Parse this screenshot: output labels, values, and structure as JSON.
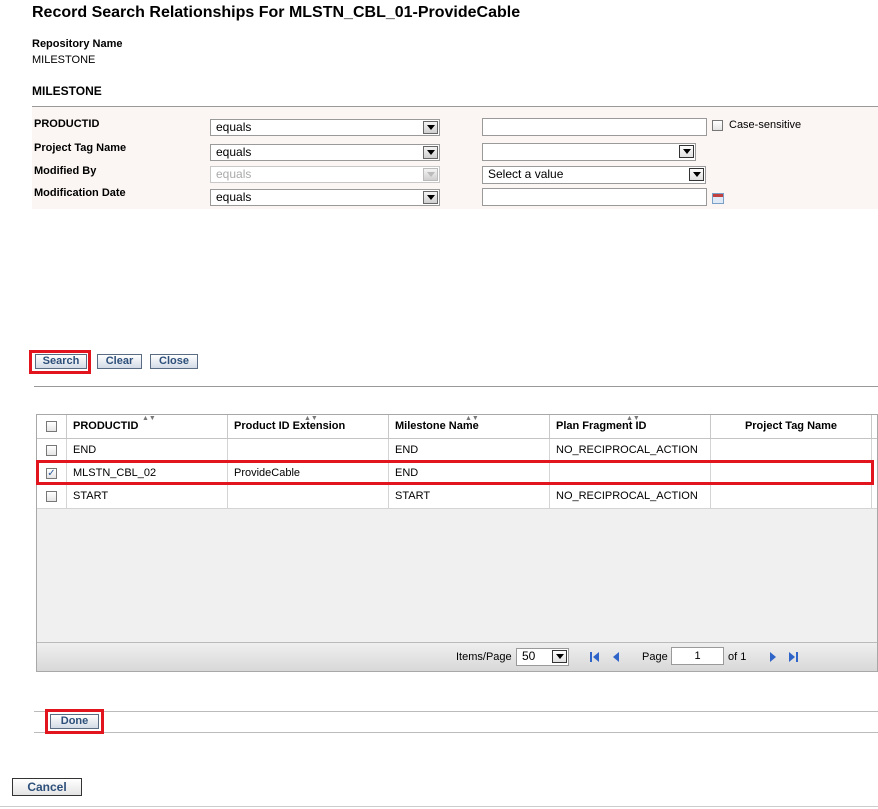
{
  "page_title": "Record Search Relationships For MLSTN_CBL_01-ProvideCable",
  "repository": {
    "label": "Repository Name",
    "value": "MILESTONE"
  },
  "section_title": "MILESTONE",
  "criteria": [
    {
      "label": "PRODUCTID",
      "operator": "equals",
      "value": "",
      "case_label": "Case-sensitive"
    },
    {
      "label": "Project Tag Name",
      "operator": "equals",
      "value": ""
    },
    {
      "label": "Modified By",
      "operator": "equals",
      "value": "Select a value"
    },
    {
      "label": "Modification Date",
      "operator": "equals",
      "value": ""
    }
  ],
  "buttons": {
    "search": "Search",
    "clear": "Clear",
    "close": "Close",
    "done": "Done",
    "cancel": "Cancel"
  },
  "table": {
    "columns": [
      "PRODUCTID",
      "Product ID Extension",
      "Milestone Name",
      "Plan Fragment ID",
      "Project Tag Name"
    ],
    "rows": [
      {
        "checked": false,
        "cells": [
          "END",
          "",
          "END",
          "NO_RECIPROCAL_ACTION",
          ""
        ]
      },
      {
        "checked": true,
        "cells": [
          "MLSTN_CBL_02",
          "ProvideCable",
          "END",
          "",
          ""
        ]
      },
      {
        "checked": false,
        "cells": [
          "START",
          "",
          "START",
          "NO_RECIPROCAL_ACTION",
          ""
        ]
      }
    ]
  },
  "pager": {
    "items_label": "Items/Page",
    "items_value": "50",
    "page_label": "Page",
    "page_value": "1",
    "of_label": "of 1"
  },
  "colors": {
    "highlight": "#e2141e",
    "button_text": "#2d4f7a",
    "nav_blue": "#2f64c8"
  },
  "icons": [
    "dropdown-arrow-icon",
    "calendar-icon",
    "sort-arrows-icon",
    "first-page-icon",
    "prev-page-icon",
    "next-page-icon",
    "last-page-icon"
  ]
}
